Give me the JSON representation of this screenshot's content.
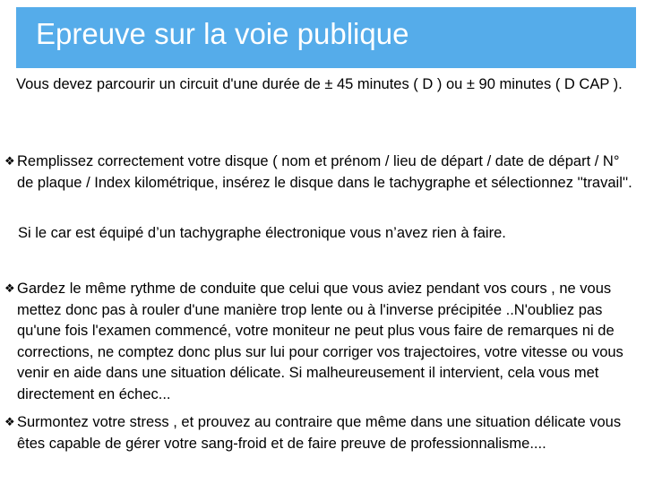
{
  "title": "Epreuve sur la voie publique",
  "bullet_marker": "❖",
  "intro": "Vous devez parcourir un circuit d'une durée de ±  45 minutes ( D ) ou ±  90 minutes ( D CAP ).",
  "bullets": [
    {
      "text": "Remplissez correctement votre disque ( nom et prénom / lieu de départ / date de départ /  N° de plaque / Index kilométrique,  insérez le disque dans le tachygraphe et sélectionnez ''travail''."
    },
    {
      "text": "Gardez le même rythme de conduite que celui que vous aviez pendant vos cours , ne vous mettez donc pas à rouler d'une manière trop lente ou à l'inverse précipitée ..N'oubliez pas qu'une fois l'examen commencé, votre moniteur ne peut plus vous faire de remarques ni de corrections, ne comptez donc plus sur lui pour corriger vos trajectoires, votre vitesse ou vous venir en aide dans une situation délicate. Si malheureusement il intervient, cela vous met directement en échec..."
    },
    {
      "text": "Surmontez votre stress , et prouvez au contraire que même dans une situation délicate vous êtes capable de gérer votre sang-froid et de faire preuve de professionnalisme...."
    }
  ],
  "note": "Si le car est équipé d’un tachygraphe électronique vous n’avez rien à faire.",
  "colors": {
    "title_bar": "#55acea",
    "title_text": "#ffffff",
    "body_text": "#000000"
  }
}
